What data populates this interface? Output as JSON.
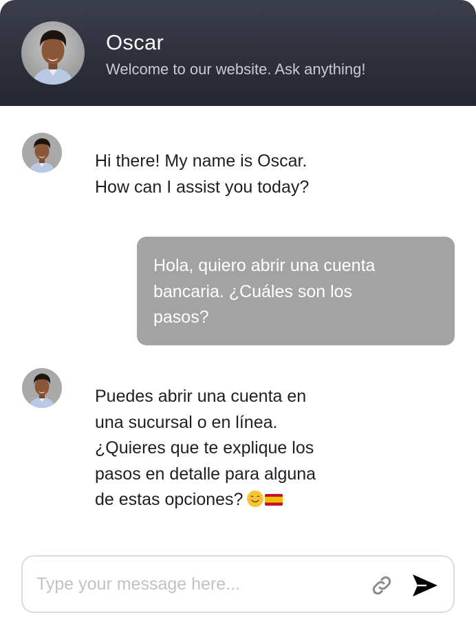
{
  "header": {
    "name": "Oscar",
    "subtitle": "Welcome to our website. Ask anything!",
    "background_top": "#3b3e4c",
    "background_bottom": "#23252f"
  },
  "messages": [
    {
      "sender": "bot",
      "text": "Hi there!  My name is Oscar.\nHow can I assist you today?"
    },
    {
      "sender": "user",
      "text": "Hola, quiero abrir una cuenta\nbancaria. ¿Cuáles son los\npasos?",
      "bubble_color": "#a3a3a3"
    },
    {
      "sender": "bot",
      "text": "Puedes abrir una cuenta en\nuna sucursal o en línea.\n¿Quieres que te explique los\npasos en detalle para alguna\nde estas opciones?",
      "emojis": [
        "smiling-face-emoji",
        "spain-flag-emoji"
      ]
    }
  ],
  "composer": {
    "placeholder": "Type your message here...",
    "value": "",
    "attach_icon": "link-icon",
    "send_icon": "send-icon"
  }
}
